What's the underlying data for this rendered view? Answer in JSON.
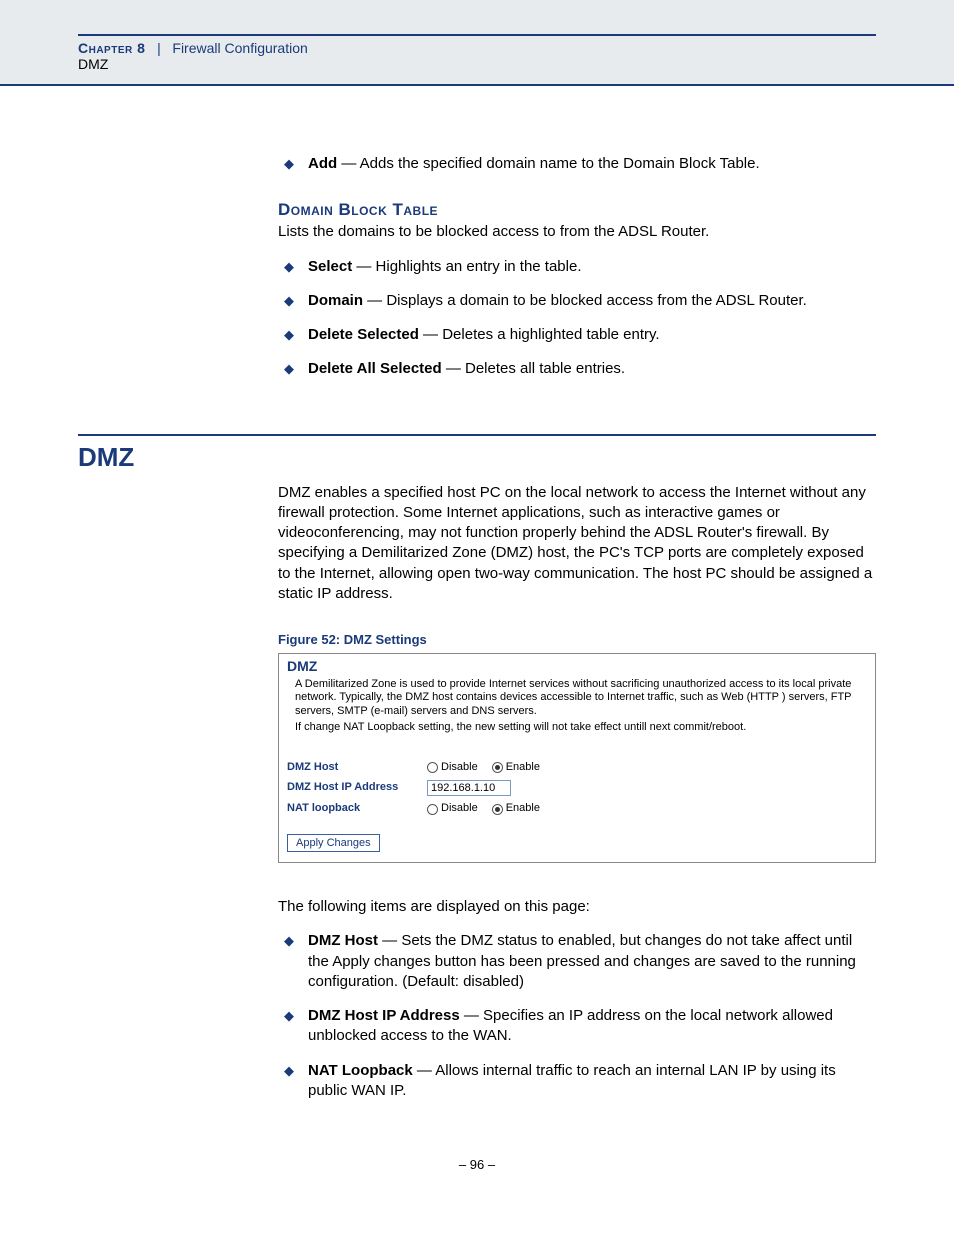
{
  "header": {
    "chapter_prefix": "Chapter 8",
    "separator": "|",
    "chapter_title": "Firewall Configuration",
    "subtitle": "DMZ"
  },
  "top_list": {
    "add": {
      "term": "Add",
      "desc": " — Adds the specified domain name to the Domain Block Table."
    }
  },
  "domain_block": {
    "heading": "Domain Block Table",
    "intro": "Lists the domains to be blocked access to from the ADSL Router.",
    "items": {
      "select": {
        "term": "Select",
        "desc": " — Highlights an entry in the table."
      },
      "domain": {
        "term": "Domain",
        "desc": " — Displays a domain to be blocked access from the ADSL Router."
      },
      "delete_selected": {
        "term": "Delete Selected",
        "desc": " — Deletes a highlighted table entry."
      },
      "delete_all": {
        "term": "Delete All Selected",
        "desc": " — Deletes all table entries."
      }
    }
  },
  "dmz": {
    "heading": "DMZ",
    "intro": "DMZ enables a specified host PC on the local network to access the Internet without any firewall protection. Some Internet applications, such as interactive games or videoconferencing, may not function properly behind the ADSL Router's firewall. By specifying a Demilitarized Zone (DMZ) host, the PC's TCP ports are completely exposed to the Internet, allowing open two-way communication. The host PC should be assigned a static IP address.",
    "figure_caption": "Figure 52:  DMZ Settings",
    "figure": {
      "title": "DMZ",
      "desc1": "A Demilitarized Zone is used to provide Internet services without sacrificing unauthorized access to its local private network. Typically, the DMZ host contains devices accessible to Internet traffic, such as Web (HTTP ) servers, FTP servers, SMTP (e-mail) servers and DNS servers.",
      "desc2": "If change NAT Loopback setting, the new setting will not take effect untill next commit/reboot.",
      "row_dmz_host": {
        "label": "DMZ Host",
        "opt_disable": "Disable",
        "opt_enable": "Enable"
      },
      "row_ip": {
        "label": "DMZ Host IP Address",
        "value": "192.168.1.10"
      },
      "row_nat": {
        "label": "NAT loopback",
        "opt_disable": "Disable",
        "opt_enable": "Enable"
      },
      "apply": "Apply Changes"
    },
    "following": "The following items are displayed on this page:",
    "items": {
      "dmz_host": {
        "term": "DMZ Host",
        "desc": " — Sets the DMZ status to enabled, but changes do not take affect until the Apply changes button has been pressed and changes are saved to the running configuration. (Default: disabled)"
      },
      "dmz_ip": {
        "term": "DMZ Host IP Address",
        "desc": " — Specifies an IP address on the local network allowed unblocked access to the WAN."
      },
      "nat_loopback": {
        "term": "NAT Loopback",
        "desc": " — Allows internal traffic to reach an internal LAN IP by using its public WAN IP."
      }
    }
  },
  "page_number": "–  96  –"
}
